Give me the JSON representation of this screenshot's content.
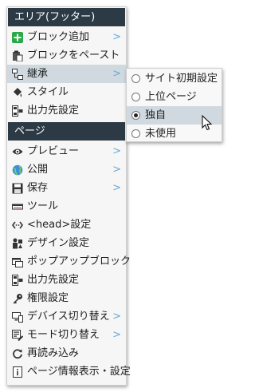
{
  "menu": {
    "section_area": "エリア(フッター)",
    "area_items": [
      {
        "label": "ブロック追加",
        "icon": "plus-icon",
        "arrow": ">"
      },
      {
        "label": "ブロックをペースト",
        "icon": "paste-icon",
        "arrow": ""
      },
      {
        "label": "継承",
        "icon": "inherit-icon",
        "arrow": ">"
      },
      {
        "label": "スタイル",
        "icon": "paint-bucket-icon",
        "arrow": ""
      },
      {
        "label": "出力先設定",
        "icon": "output-icon",
        "arrow": ""
      }
    ],
    "section_page": "ページ",
    "page_items": [
      {
        "label": "プレビュー",
        "icon": "eye-icon",
        "arrow": ">"
      },
      {
        "label": "公開",
        "icon": "globe-icon",
        "arrow": ">"
      },
      {
        "label": "保存",
        "icon": "save-icon",
        "arrow": ">"
      },
      {
        "label": "ツール",
        "icon": "toolbar-icon",
        "arrow": ""
      },
      {
        "label": "<head>設定",
        "icon": "code-icon",
        "arrow": ""
      },
      {
        "label": "デザイン設定",
        "icon": "design-icon",
        "arrow": ""
      },
      {
        "label": "ポップアップブロック",
        "icon": "popup-icon",
        "arrow": ""
      },
      {
        "label": "出力先設定",
        "icon": "output-icon",
        "arrow": ""
      },
      {
        "label": "権限設定",
        "icon": "key-icon",
        "arrow": ""
      },
      {
        "label": "デバイス切り替え",
        "icon": "device-icon",
        "arrow": ">"
      },
      {
        "label": "モード切り替え",
        "icon": "mode-icon",
        "arrow": ">"
      },
      {
        "label": "再読み込み",
        "icon": "reload-icon",
        "arrow": ""
      },
      {
        "label": "ページ情報表示・設定",
        "icon": "info-icon",
        "arrow": ""
      }
    ]
  },
  "submenu": {
    "options": [
      {
        "label": "サイト初期設定",
        "selected": false
      },
      {
        "label": "上位ページ",
        "selected": false
      },
      {
        "label": "独自",
        "selected": true
      },
      {
        "label": "未使用",
        "selected": false
      }
    ]
  },
  "colors": {
    "header_bg": "#2b3a44",
    "highlight": "#cfd9df",
    "arrow": "#6aa9d6",
    "plus_green": "#2aa84a"
  }
}
